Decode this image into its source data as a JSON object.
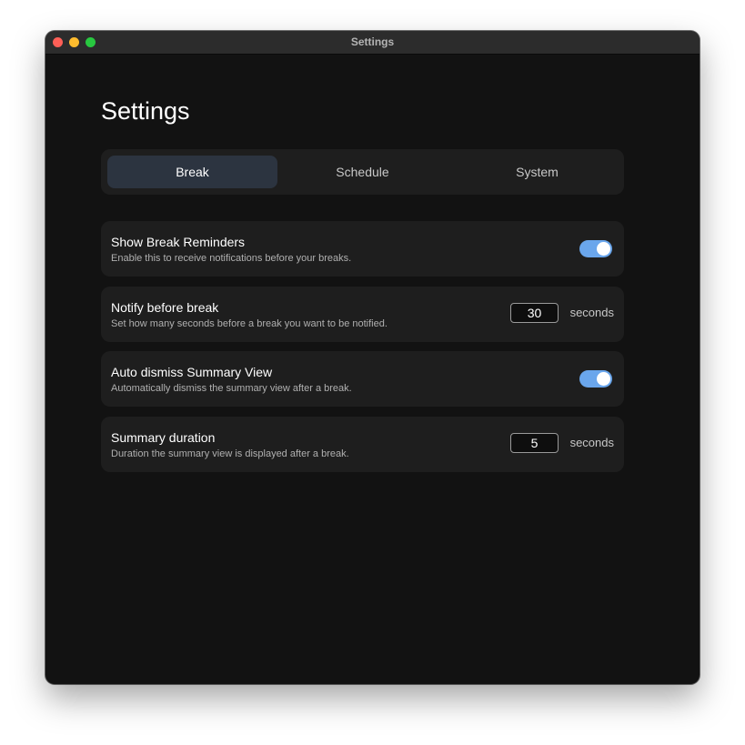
{
  "window": {
    "title": "Settings",
    "controls": {
      "close_color": "#fe5f57",
      "minimize_color": "#febc2e",
      "zoom_color": "#28c840"
    }
  },
  "page": {
    "title": "Settings"
  },
  "tabs": [
    {
      "label": "Break",
      "active": true
    },
    {
      "label": "Schedule",
      "active": false
    },
    {
      "label": "System",
      "active": false
    }
  ],
  "colors": {
    "accent": "#6aa6ec",
    "background": "#121212",
    "card": "#1e1e1e",
    "active_tab": "#2c3440"
  },
  "settings": [
    {
      "label": "Show Break Reminders",
      "description": "Enable this to receive notifications before your breaks.",
      "control": "toggle",
      "enabled": true
    },
    {
      "label": "Notify before break",
      "description": "Set how many seconds before a break you want to be notified.",
      "control": "number",
      "value": "30",
      "unit": "seconds"
    },
    {
      "label": "Auto dismiss Summary View",
      "description": "Automatically dismiss the summary view after a break.",
      "control": "toggle",
      "enabled": true
    },
    {
      "label": "Summary duration",
      "description": "Duration the summary view is displayed after a break.",
      "control": "number",
      "value": "5",
      "unit": "seconds"
    }
  ]
}
